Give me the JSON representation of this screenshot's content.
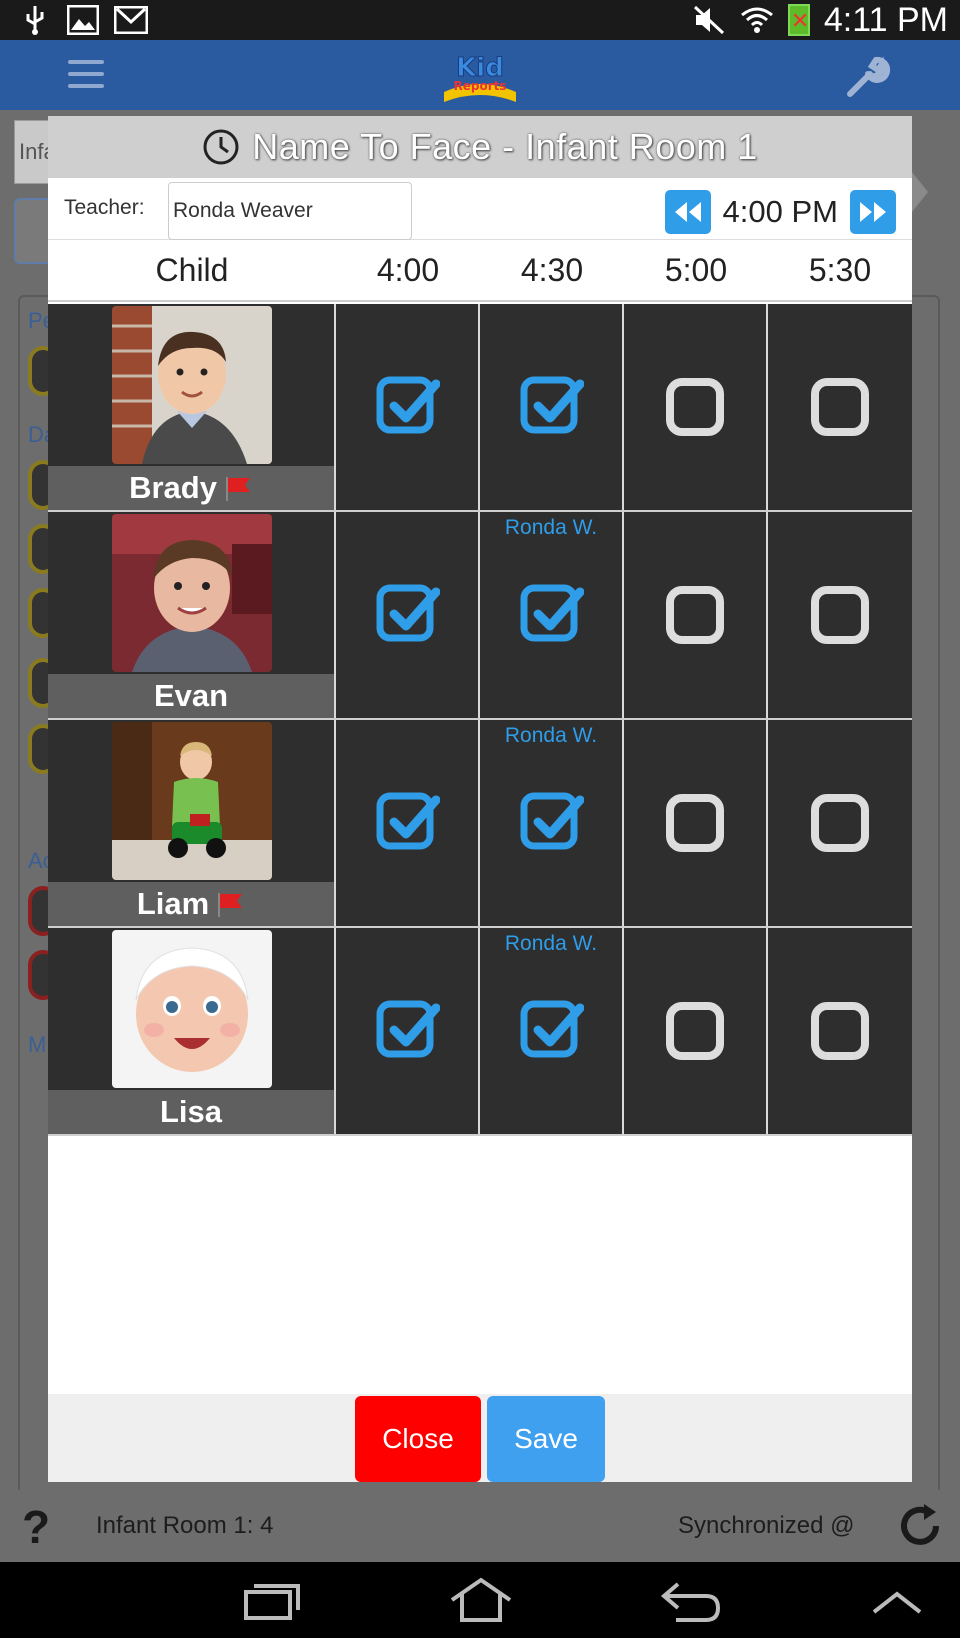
{
  "status_bar": {
    "time": "4:11 PM",
    "icons": [
      "usb-icon",
      "image-icon",
      "gmail-icon",
      "mute-icon",
      "wifi-icon",
      "battery-icon"
    ]
  },
  "app_bar": {
    "logo_text": "Kid Reports",
    "icons": [
      "menu-icon",
      "wrench-icon"
    ]
  },
  "background": {
    "room_field_fragment": "Infa",
    "section_fragments": [
      "Pe",
      "Da",
      "Ac",
      "M"
    ]
  },
  "modal": {
    "title": "Name To Face - Infant Room 1",
    "teacher_label": "Teacher:",
    "teacher_value": "Ronda Weaver",
    "current_time": "4:00 PM",
    "columns": {
      "child": "Child",
      "times": [
        "4:00",
        "4:30",
        "5:00",
        "5:30"
      ]
    },
    "children": [
      {
        "name": "Brady",
        "flagged": true,
        "tag_430": "",
        "checks": [
          true,
          true,
          false,
          false
        ]
      },
      {
        "name": "Evan",
        "flagged": false,
        "tag_430": "Ronda W.",
        "checks": [
          true,
          true,
          false,
          false
        ]
      },
      {
        "name": "Liam",
        "flagged": true,
        "tag_430": "Ronda W.",
        "checks": [
          true,
          true,
          false,
          false
        ]
      },
      {
        "name": "Lisa",
        "flagged": false,
        "tag_430": "Ronda W.",
        "checks": [
          true,
          true,
          false,
          false
        ]
      }
    ],
    "buttons": {
      "close": "Close",
      "save": "Save"
    }
  },
  "footer": {
    "help": "?",
    "room_count": "Infant Room 1: 4",
    "sync_text": "Synchronized @"
  },
  "colors": {
    "accent_blue": "#2f9de8",
    "close_red": "#ff0000",
    "app_bar": "#2a5aa0",
    "cell_dark": "#2e2e2e"
  }
}
